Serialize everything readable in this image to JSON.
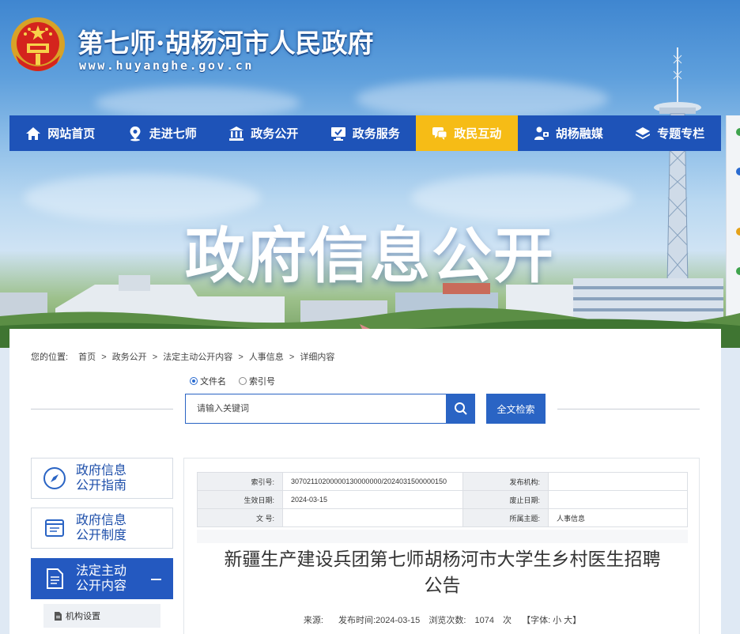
{
  "site": {
    "title": "第七师·胡杨河市人民政府",
    "url": "www.huyanghe.gov.cn"
  },
  "nav": [
    {
      "label": "网站首页",
      "icon": "home-icon",
      "active": false
    },
    {
      "label": "走进七师",
      "icon": "location-pin-icon",
      "active": false
    },
    {
      "label": "政务公开",
      "icon": "government-building-icon",
      "active": false
    },
    {
      "label": "政务服务",
      "icon": "monitor-check-icon",
      "active": false
    },
    {
      "label": "政民互动",
      "icon": "chat-bubble-icon",
      "active": true
    },
    {
      "label": "胡杨融媒",
      "icon": "camera-person-icon",
      "active": false
    },
    {
      "label": "专题专栏",
      "icon": "layers-icon",
      "active": false
    }
  ],
  "banner": {
    "title": "政府信息公开"
  },
  "breadcrumb": {
    "prefix": "您的位置:",
    "items": [
      "首页",
      "政务公开",
      "法定主动公开内容",
      "人事信息",
      "详细内容"
    ],
    "separator": ">"
  },
  "search": {
    "options": [
      {
        "label": "文件名",
        "checked": true
      },
      {
        "label": "索引号",
        "checked": false
      }
    ],
    "placeholder": "请输入关键词",
    "fulltext_label": "全文检索"
  },
  "sidebar": {
    "items": [
      {
        "line1": "政府信息",
        "line2": "公开指南",
        "icon": "compass-icon",
        "active": false
      },
      {
        "line1": "政府信息",
        "line2": "公开制度",
        "icon": "book-icon",
        "active": false
      },
      {
        "line1": "法定主动",
        "line2": "公开内容",
        "icon": "document-icon",
        "active": true
      }
    ],
    "subitem": "机构设置"
  },
  "meta": {
    "index_label": "索引号:",
    "index_value": "30702110200000130000000/2024031500000150",
    "publisher_label": "发布机构:",
    "publisher_value": "",
    "effective_label": "生效日期:",
    "effective_value": "2024-03-15",
    "expiry_label": "废止日期:",
    "expiry_value": "",
    "docno_label": "文 号:",
    "docno_value": "",
    "topic_label": "所属主题:",
    "topic_value": "人事信息"
  },
  "article": {
    "title": "新疆生产建设兵团第七师胡杨河市大学生乡村医生招聘公告",
    "source_label": "来源:",
    "publish_label": "发布时间:",
    "publish_date": "2024-03-15",
    "views_label": "浏览次数:",
    "views": "1074",
    "views_unit": "次",
    "font_label": "【字体:",
    "font_small": "小",
    "font_large": "大",
    "font_close": "】"
  },
  "colors": {
    "nav_bg": "#1e53b8",
    "nav_active": "#f6bc16",
    "accent_blue": "#2a64c4",
    "sidebar_active": "#2459c0"
  }
}
